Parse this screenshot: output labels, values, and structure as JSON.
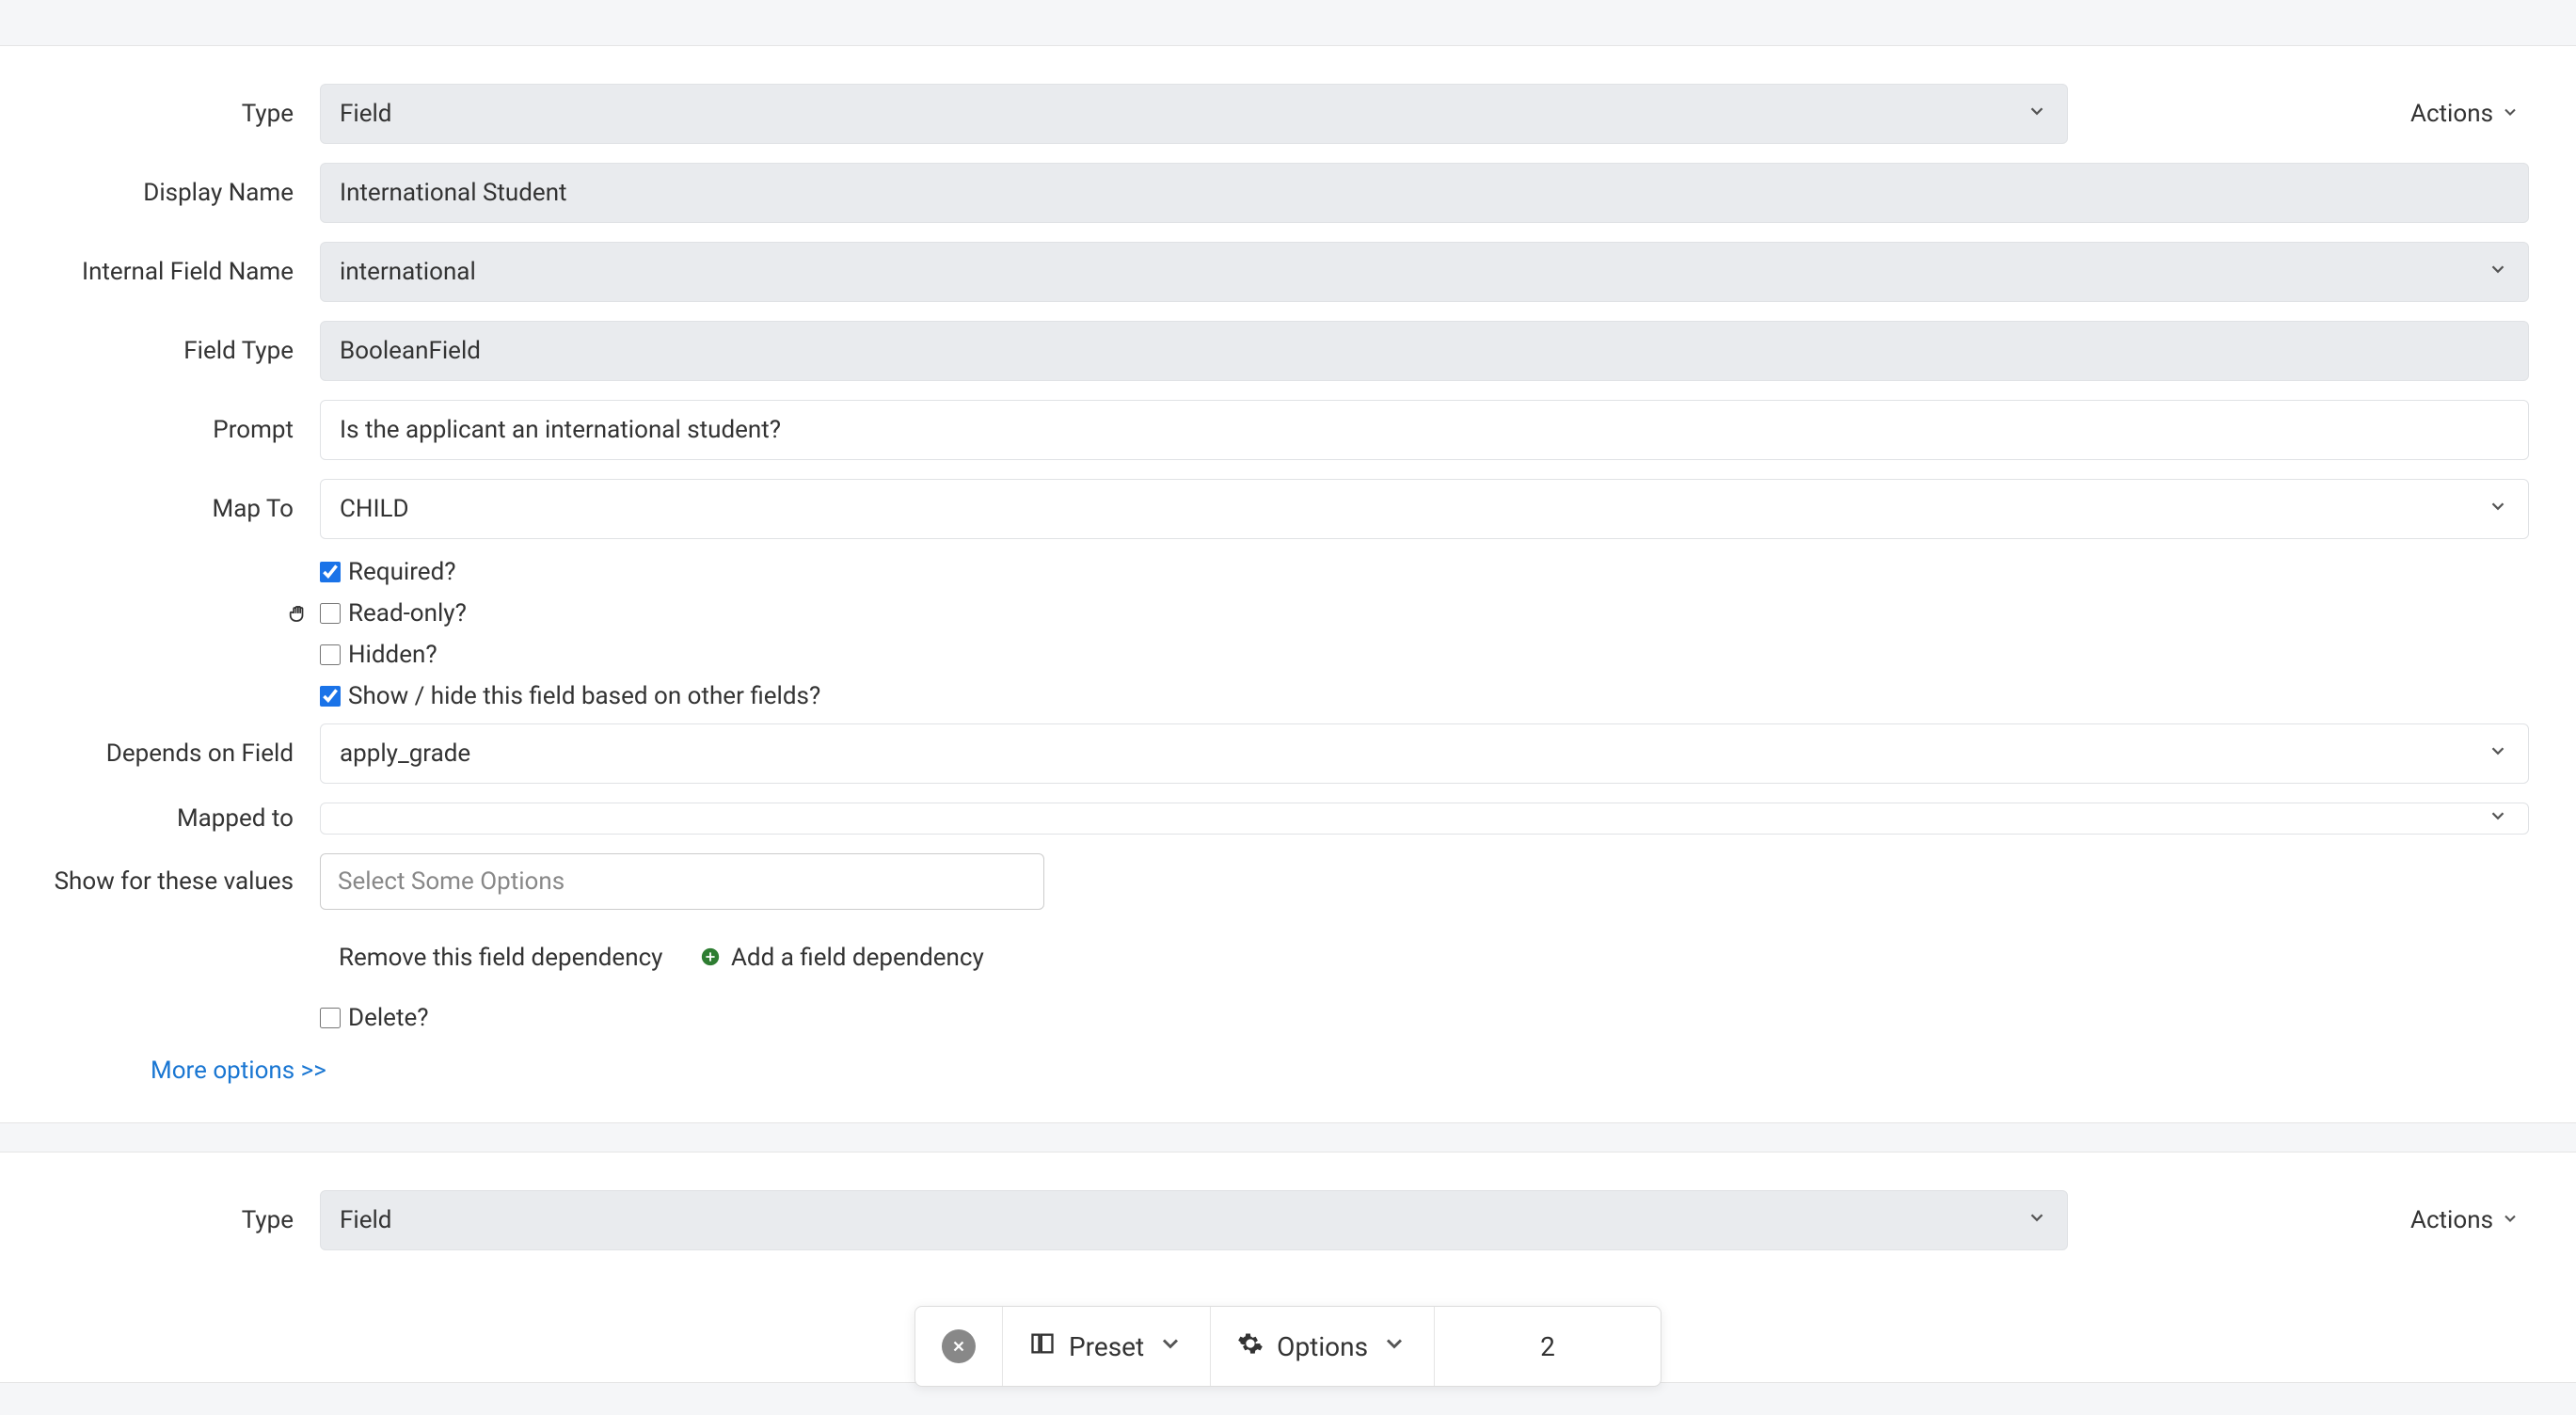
{
  "section1": {
    "labels": {
      "type": "Type",
      "displayName": "Display Name",
      "internalFieldName": "Internal Field Name",
      "fieldType": "Field Type",
      "prompt": "Prompt",
      "mapTo": "Map To",
      "dependsOnField": "Depends on Field",
      "mappedTo": "Mapped to",
      "showForTheseValues": "Show for these values"
    },
    "values": {
      "type": "Field",
      "displayName": "International Student",
      "internalFieldName": "international",
      "fieldType": "BooleanField",
      "prompt": "Is the applicant an international student?",
      "mapTo": "CHILD",
      "dependsOnField": "apply_grade",
      "mappedTo": "",
      "showForTheseValuesPlaceholder": "Select Some Options"
    },
    "checkboxes": {
      "required": {
        "label": "Required?",
        "checked": true
      },
      "readonly": {
        "label": "Read-only?",
        "checked": false
      },
      "hidden": {
        "label": "Hidden?",
        "checked": false
      },
      "showHide": {
        "label": "Show / hide this field based on other fields?",
        "checked": true
      },
      "delete": {
        "label": "Delete?",
        "checked": false
      }
    },
    "links": {
      "removeDependency": "Remove this field dependency",
      "addDependency": "Add a field dependency",
      "moreOptions": "More options >>"
    },
    "actions": "Actions"
  },
  "section2": {
    "labels": {
      "type": "Type"
    },
    "values": {
      "type": "Field"
    },
    "actions": "Actions"
  },
  "toolbar": {
    "preset": "Preset",
    "options": "Options",
    "page": "2"
  }
}
